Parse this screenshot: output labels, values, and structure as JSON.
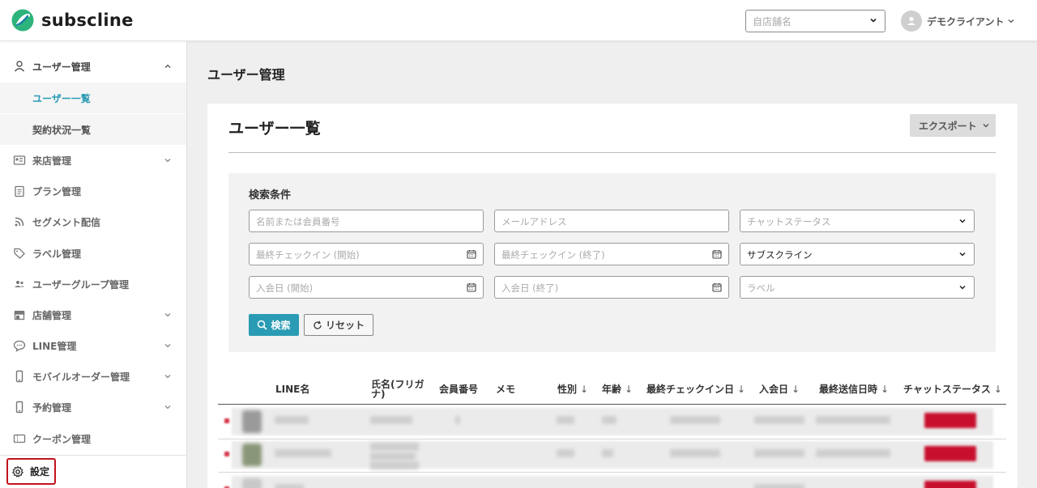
{
  "header": {
    "brand": "subscline",
    "brand_color": "#2a9bb4",
    "store_select_placeholder": "自店舗名",
    "user_name": "デモクライアント"
  },
  "sidebar": {
    "items": [
      {
        "label": "ユーザー管理",
        "icon": "person-icon",
        "expanded": true
      },
      {
        "label": "ユーザー一覧",
        "sub": true,
        "active": true
      },
      {
        "label": "契約状況一覧",
        "sub": true
      },
      {
        "label": "来店管理",
        "icon": "id-card-icon"
      },
      {
        "label": "プラン管理",
        "icon": "clipboard-icon"
      },
      {
        "label": "セグメント配信",
        "icon": "rss-icon"
      },
      {
        "label": "ラベル管理",
        "icon": "tag-icon"
      },
      {
        "label": "ユーザーグループ管理",
        "icon": "group-icon"
      },
      {
        "label": "店舗管理",
        "icon": "store-icon"
      },
      {
        "label": "LINE管理",
        "icon": "chat-icon"
      },
      {
        "label": "モバイルオーダー管理",
        "icon": "phone-icon"
      },
      {
        "label": "予約管理",
        "icon": "phone-icon"
      },
      {
        "label": "クーポン管理",
        "icon": "coupon-icon"
      }
    ],
    "settings_label": "設定"
  },
  "main": {
    "page_title": "ユーザー管理",
    "card_title": "ユーザー一覧",
    "export_label": "エクスポート",
    "search": {
      "title": "検索条件",
      "name_placeholder": "名前または会員番号",
      "email_placeholder": "メールアドレス",
      "chat_status_placeholder": "チャットステータス",
      "checkin_start_placeholder": "最終チェックイン (開始)",
      "checkin_end_placeholder": "最終チェックイン (終了)",
      "service_value": "サブスクライン",
      "join_start_placeholder": "入会日 (開始)",
      "join_end_placeholder": "入会日 (終了)",
      "label_placeholder": "ラベル",
      "search_button": "検索",
      "reset_button": "リセット"
    },
    "table": {
      "columns": [
        "LINE名",
        "氏名(フリガナ)",
        "会員番号",
        "メモ",
        "性別",
        "年齢",
        "最終チェックイン日",
        "入会日",
        "最終送信日時",
        "チャットステータス"
      ],
      "sort_arrow": "↓"
    }
  }
}
